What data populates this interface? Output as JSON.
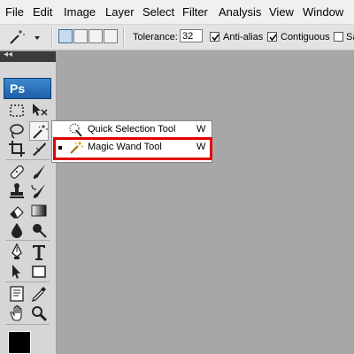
{
  "menu": [
    "File",
    "Edit",
    "Image",
    "Layer",
    "Select",
    "Filter",
    "Analysis",
    "View",
    "Window"
  ],
  "options": {
    "tolerance_label": "Tolerance:",
    "tolerance_value": "32",
    "antialias_label": "Anti-alias",
    "contiguous_label": "Contiguous",
    "sample_label": "Sa"
  },
  "tools_panel": {
    "logo": "Ps",
    "collapse_glyph": "◂◂"
  },
  "flyout": {
    "items": [
      {
        "label": "Quick Selection Tool",
        "shortcut": "W",
        "selected": false
      },
      {
        "label": "Magic Wand Tool",
        "shortcut": "W",
        "selected": true
      }
    ]
  },
  "colors": {
    "canvas": "#a7a7a7",
    "highlight": "#e30000",
    "logo_blue": "#1e5ea8"
  }
}
